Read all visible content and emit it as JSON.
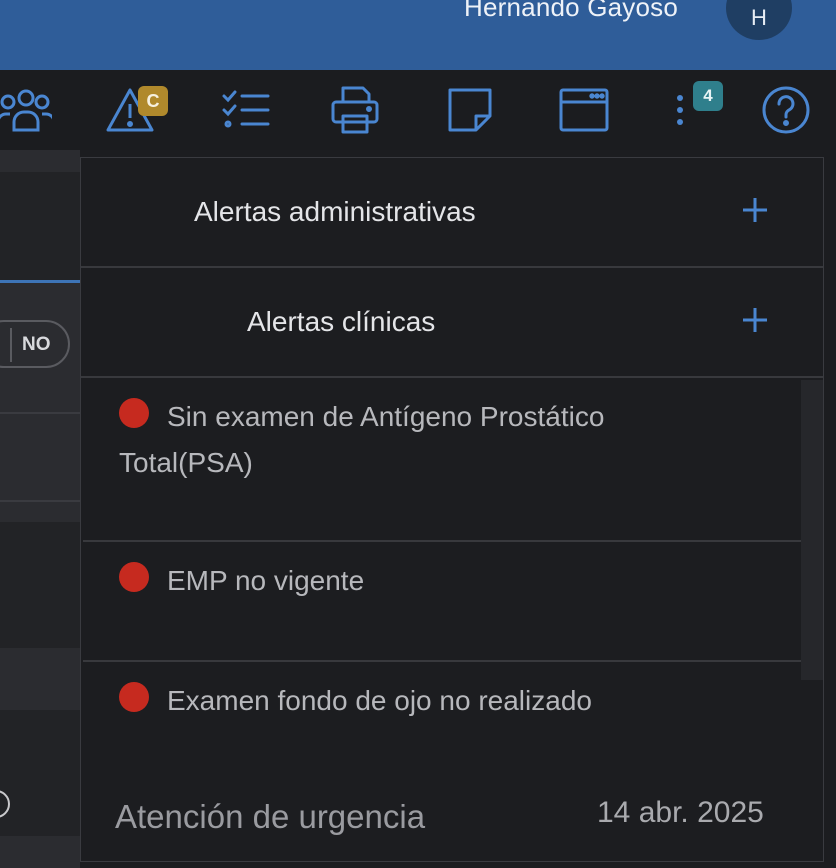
{
  "header": {
    "user_name": "Hernando Gayoso",
    "avatar_initial": "H",
    "background_color": "#2f5d99"
  },
  "toolbar": {
    "icons": [
      "users-icon",
      "alert-triangle-icon",
      "checklist-icon",
      "printer-icon",
      "sticky-note-icon",
      "browser-window-icon",
      "more-vertical-icon",
      "help-icon"
    ],
    "alert_badge": "C",
    "more_badge": "4",
    "icon_color": "#4a86d1"
  },
  "left_panel": {
    "toggle_label": "NO"
  },
  "popover": {
    "admin_alerts_title": "Alertas administrativas",
    "clinical_alerts_title": "Alertas clínicas",
    "alerts": [
      "Sin examen de Antígeno Prostático Total(PSA)",
      "EMP no vigente",
      "Examen fondo de ojo no realizado"
    ],
    "alert_dot_color": "#c62a1f",
    "footer_label": "Atención de urgencia",
    "footer_date": "14 abr. 2025"
  }
}
